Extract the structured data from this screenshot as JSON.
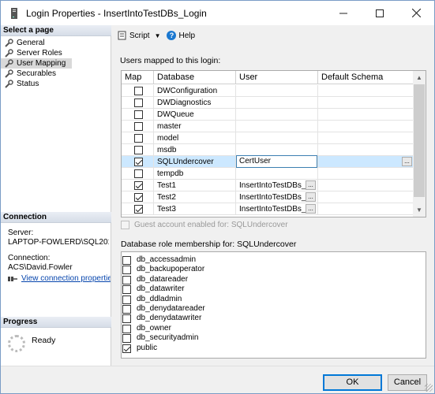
{
  "window": {
    "title": "Login Properties - InsertIntoTestDBs_Login"
  },
  "sidebar": {
    "header": "Select a page",
    "items": [
      {
        "label": "General"
      },
      {
        "label": "Server Roles"
      },
      {
        "label": "User Mapping"
      },
      {
        "label": "Securables"
      },
      {
        "label": "Status"
      }
    ]
  },
  "connection": {
    "header": "Connection",
    "server_label": "Server:",
    "server_value": "LAPTOP-FOWLERD\\SQL2019",
    "conn_label": "Connection:",
    "conn_value": "ACS\\David.Fowler",
    "view_link": "View connection properties"
  },
  "progress": {
    "header": "Progress",
    "status": "Ready"
  },
  "toolbar": {
    "script": "Script",
    "help": "Help"
  },
  "mapping": {
    "label": "Users mapped to this login:",
    "columns": [
      "Map",
      "Database",
      "User",
      "Default Schema"
    ],
    "rows": [
      {
        "map": false,
        "db": "DWConfiguration",
        "user": "",
        "schema": "",
        "selected": false
      },
      {
        "map": false,
        "db": "DWDiagnostics",
        "user": "",
        "schema": "",
        "selected": false
      },
      {
        "map": false,
        "db": "DWQueue",
        "user": "",
        "schema": "",
        "selected": false
      },
      {
        "map": false,
        "db": "master",
        "user": "",
        "schema": "",
        "selected": false
      },
      {
        "map": false,
        "db": "model",
        "user": "",
        "schema": "",
        "selected": false
      },
      {
        "map": false,
        "db": "msdb",
        "user": "",
        "schema": "",
        "selected": false
      },
      {
        "map": true,
        "db": "SQLUndercover",
        "user": "CertUser",
        "schema": "",
        "selected": true
      },
      {
        "map": false,
        "db": "tempdb",
        "user": "",
        "schema": "",
        "selected": false
      },
      {
        "map": true,
        "db": "Test1",
        "user": "InsertIntoTestDBs_...",
        "schema": "",
        "selected": false
      },
      {
        "map": true,
        "db": "Test2",
        "user": "InsertIntoTestDBs_...",
        "schema": "",
        "selected": false
      },
      {
        "map": true,
        "db": "Test3",
        "user": "InsertIntoTestDBs_...",
        "schema": "",
        "selected": false
      }
    ],
    "ellipsis": "..."
  },
  "guest": {
    "label": "Guest account enabled for: SQLUndercover",
    "checked": false
  },
  "roles": {
    "label": "Database role membership for: SQLUndercover",
    "items": [
      {
        "name": "db_accessadmin",
        "checked": false
      },
      {
        "name": "db_backupoperator",
        "checked": false
      },
      {
        "name": "db_datareader",
        "checked": false
      },
      {
        "name": "db_datawriter",
        "checked": false
      },
      {
        "name": "db_ddladmin",
        "checked": false
      },
      {
        "name": "db_denydatareader",
        "checked": false
      },
      {
        "name": "db_denydatawriter",
        "checked": false
      },
      {
        "name": "db_owner",
        "checked": false
      },
      {
        "name": "db_securityadmin",
        "checked": false
      },
      {
        "name": "public",
        "checked": true
      }
    ]
  },
  "footer": {
    "ok": "OK",
    "cancel": "Cancel"
  }
}
